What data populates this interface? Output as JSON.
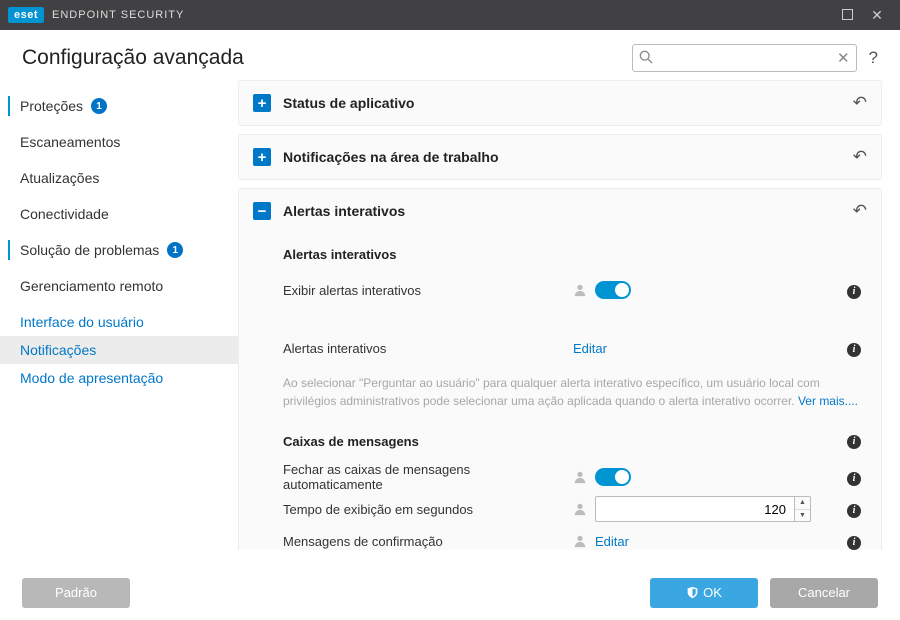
{
  "title_bar": {
    "brand": "eset",
    "product": "ENDPOINT SECURITY"
  },
  "page_title": "Configuração avançada",
  "search": {
    "placeholder": ""
  },
  "sidebar": {
    "items": [
      {
        "label": "Proteções",
        "badge": "1"
      },
      {
        "label": "Escaneamentos"
      },
      {
        "label": "Atualizações"
      },
      {
        "label": "Conectividade"
      },
      {
        "label": "Solução de problemas",
        "badge": "1"
      },
      {
        "label": "Gerenciamento remoto"
      }
    ],
    "sub": [
      {
        "label": "Interface do usuário"
      },
      {
        "label": "Notificações"
      },
      {
        "label": "Modo de apresentação"
      }
    ]
  },
  "panels": {
    "status": {
      "title": "Status de aplicativo"
    },
    "desktop_notif": {
      "title": "Notificações na área de trabalho"
    },
    "interactive": {
      "title": "Alertas interativos",
      "group1_title": "Alertas interativos",
      "show_alerts_label": "Exibir alertas interativos",
      "edit_label": "Alertas interativos",
      "edit_link": "Editar",
      "hint": "Ao selecionar \"Perguntar ao usuário\" para qualquer alerta interativo específico, um usuário local com privilégios administrativos pode selecionar uma ação aplicada quando o alerta interativo ocorrer. ",
      "hint_more": "Ver mais....",
      "group2_title": "Caixas de mensagens",
      "auto_close_label": "Fechar as caixas de mensagens automaticamente",
      "timeout_label": "Tempo de exibição em segundos",
      "timeout_value": "120",
      "confirm_label": "Mensagens de confirmação",
      "confirm_link": "Editar"
    }
  },
  "footer": {
    "default": "Padrão",
    "ok": "OK",
    "cancel": "Cancelar"
  }
}
